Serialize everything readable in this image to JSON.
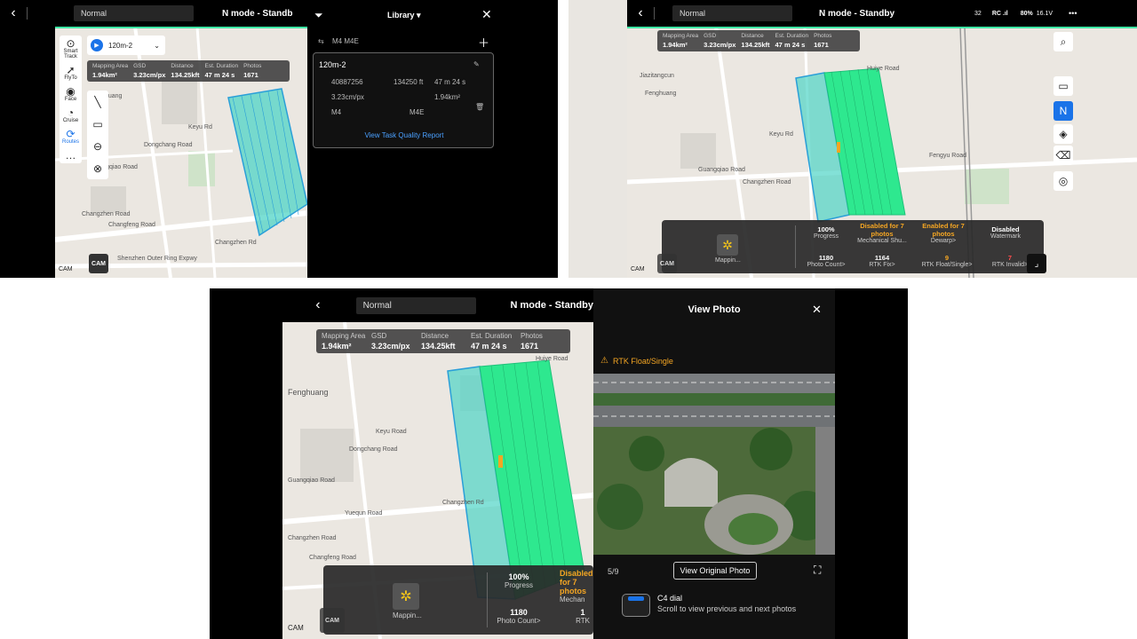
{
  "p1": {
    "mode": "Normal",
    "status": "N mode - Standb",
    "library": "Library ▾",
    "task_pill": "120m-2",
    "info": [
      {
        "label": "Mapping Area",
        "value": "1.94km²"
      },
      {
        "label": "GSD",
        "value": "3.23cm/px"
      },
      {
        "label": "Distance",
        "value": "134.25kft"
      },
      {
        "label": "Est. Duration",
        "value": "47 m 24 s"
      },
      {
        "label": "Photos",
        "value": "1671"
      }
    ],
    "tools": [
      {
        "label": "Smart Track",
        "icon": "⊙"
      },
      {
        "label": "FlyTo",
        "icon": "➚"
      },
      {
        "label": "Face",
        "icon": "◉"
      },
      {
        "label": "Cruise",
        "icon": "◔"
      },
      {
        "label": "Routes",
        "icon": "⟳"
      },
      {
        "label": "",
        "icon": "…"
      }
    ],
    "card": {
      "drones": "M4  M4E",
      "title": "120m-2",
      "id": "40887256",
      "dist": "134250 ft",
      "time": "47 m 24 s",
      "gsd": "3.23cm/px",
      "area": "1.94km²",
      "drone1": "M4",
      "drone2": "M4E",
      "report": "View Task Quality Report"
    },
    "roads": [
      "Fenghuang",
      "Guangqiao Road",
      "Changzhen Road",
      "Changfeng Road",
      "Changzhen Rd",
      "Shenzhen Outer Ring Expwy",
      "Keyu Rd",
      "Dongchang Road"
    ],
    "cam": "CAM"
  },
  "p2": {
    "mode": "Normal",
    "status": "N mode - Standby",
    "signal": "32",
    "rc": "RC .ıl",
    "battery": "80%",
    "voltage": "16.1V",
    "more": "•••",
    "info": [
      {
        "label": "Mapping Area",
        "value": "1.94km²"
      },
      {
        "label": "GSD",
        "value": "3.23cm/px"
      },
      {
        "label": "Distance",
        "value": "134.25kft"
      },
      {
        "label": "Est. Duration",
        "value": "47 m 24 s"
      },
      {
        "label": "Photos",
        "value": "1671"
      }
    ],
    "roads": [
      "Jiazitangcun",
      "Fenghuang",
      "Guangqiao Road",
      "Changzhen Road",
      "Fengyu Road",
      "Keyu Rd",
      "Huiye Road"
    ],
    "mapping_label": "Mappin...",
    "stats_top": [
      {
        "v": "100%",
        "l": "Progress",
        "c": ""
      },
      {
        "v": "Disabled for 7 photos",
        "l": "Mechanical Shu...",
        "c": "orange"
      },
      {
        "v": "Enabled for 7 photos",
        "l": "Dewarp>",
        "c": "orange"
      },
      {
        "v": "Disabled",
        "l": "Watermark",
        "c": ""
      }
    ],
    "stats_bottom": [
      {
        "v": "1180",
        "l": "Photo Count>",
        "c": ""
      },
      {
        "v": "1164",
        "l": "RTK Fix>",
        "c": ""
      },
      {
        "v": "9",
        "l": "RTK Float/Single>",
        "c": "orange"
      },
      {
        "v": "7",
        "l": "RTK Invalid>",
        "c": "red"
      }
    ],
    "cam": "CAM"
  },
  "p3": {
    "mode": "Normal",
    "status": "N mode - Standby",
    "info": [
      {
        "label": "Mapping Area",
        "value": "1.94km²"
      },
      {
        "label": "GSD",
        "value": "3.23cm/px"
      },
      {
        "label": "Distance",
        "value": "134.25kft"
      },
      {
        "label": "Est. Duration",
        "value": "47 m 24 s"
      },
      {
        "label": "Photos",
        "value": "1671"
      }
    ],
    "roads": [
      "Fenghuang",
      "Guangqiao Road",
      "Changzhen Road",
      "Changfeng Road",
      "Changzhen Rd",
      "Keyu Road",
      "Dongchang Road",
      "Yuequn Road",
      "Huiye Road"
    ],
    "mapping_label": "Mappin...",
    "stats": [
      {
        "v": "100%",
        "l": "Progress",
        "c": ""
      },
      {
        "v": "Disabled for 7 photos",
        "l": "Mechan",
        "c": "orange"
      },
      {
        "v": "1180",
        "l": "Photo Count>",
        "c": ""
      },
      {
        "v": "1",
        "l": "RTK",
        "c": ""
      }
    ],
    "photo": {
      "title": "View Photo",
      "warning": "RTK Float/Single",
      "counter": "5/9",
      "original_btn": "View Original Photo",
      "dial_title": "C4 dial",
      "dial_text": "Scroll to view previous and next photos"
    },
    "cam": "CAM"
  }
}
